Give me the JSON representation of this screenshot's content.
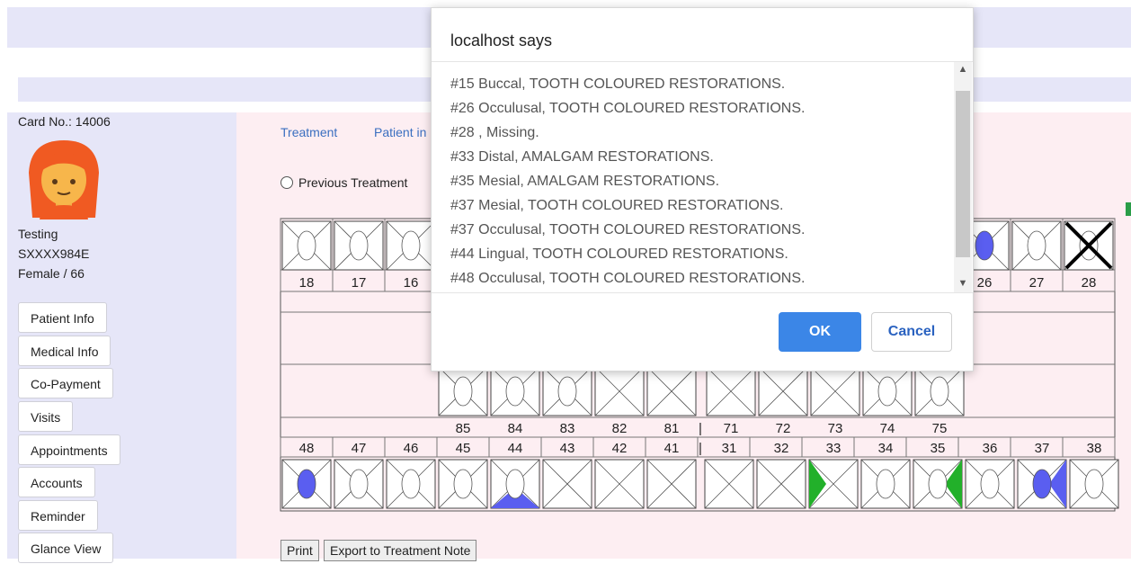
{
  "patient": {
    "card_label": "Card No.: 14006",
    "name": "Testing",
    "id": "SXXXX984E",
    "gender_age": "Female / 66"
  },
  "sidebar": {
    "items": [
      {
        "label": "Patient Info"
      },
      {
        "label": "Medical Info"
      },
      {
        "label": "Co-Payment"
      },
      {
        "label": "Visits"
      },
      {
        "label": "Appointments"
      },
      {
        "label": "Accounts"
      },
      {
        "label": "Reminder"
      },
      {
        "label": "Glance View"
      }
    ]
  },
  "tabs": [
    {
      "label": "Treatment"
    },
    {
      "label": "Patient in"
    }
  ],
  "radio": {
    "previous_label": "Previous Treatment"
  },
  "chart": {
    "upper_adult": [
      "18",
      "17",
      "16",
      "26",
      "27",
      "28"
    ],
    "upper_primary": [],
    "lower_primary": [
      "85",
      "84",
      "83",
      "82",
      "81",
      "71",
      "72",
      "73",
      "74",
      "75"
    ],
    "lower_adult": [
      "48",
      "47",
      "46",
      "45",
      "44",
      "43",
      "42",
      "41",
      "31",
      "32",
      "33",
      "34",
      "35",
      "36",
      "37",
      "38"
    ],
    "separator": "|",
    "highlight_blue": "#5a5ef0",
    "highlight_green": "#22b02a"
  },
  "footer": {
    "print_label": "Print",
    "export_label": "Export to Treatment Note"
  },
  "dialog": {
    "title": "localhost says",
    "lines": [
      "#15 Buccal, TOOTH COLOURED RESTORATIONS.",
      "#26 Occulusal, TOOTH COLOURED RESTORATIONS.",
      "#28 , Missing.",
      "#33 Distal, AMALGAM RESTORATIONS.",
      "#35 Mesial, AMALGAM RESTORATIONS.",
      "#37 Mesial, TOOTH COLOURED RESTORATIONS.",
      "#37 Occulusal, TOOTH COLOURED RESTORATIONS.",
      "#44 Lingual, TOOTH COLOURED RESTORATIONS.",
      "#48 Occulusal, TOOTH COLOURED RESTORATIONS."
    ],
    "ok_label": "OK",
    "cancel_label": "Cancel",
    "accent": "#3b86e7"
  }
}
